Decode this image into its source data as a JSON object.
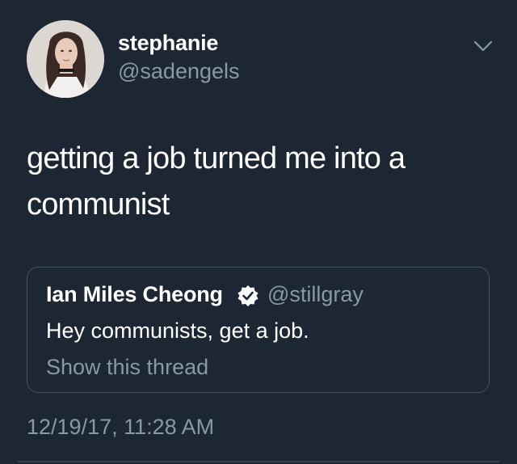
{
  "tweet": {
    "author": {
      "display_name": "stephanie",
      "handle": "@sadengels"
    },
    "text": "getting a job turned me into a communist",
    "timestamp": "12/19/17, 11:28 AM",
    "menu_icon": "chevron-down-icon",
    "quoted": {
      "display_name": "Ian Miles Cheong",
      "verified_icon": "verified-badge-icon",
      "handle": "@stillgray",
      "text": "Hey communists, get a job.",
      "thread_link": "Show this thread"
    }
  },
  "colors": {
    "background": "#1c2733",
    "text_primary": "#ffffff",
    "text_secondary": "#8899a6",
    "border": "#3d5466"
  }
}
